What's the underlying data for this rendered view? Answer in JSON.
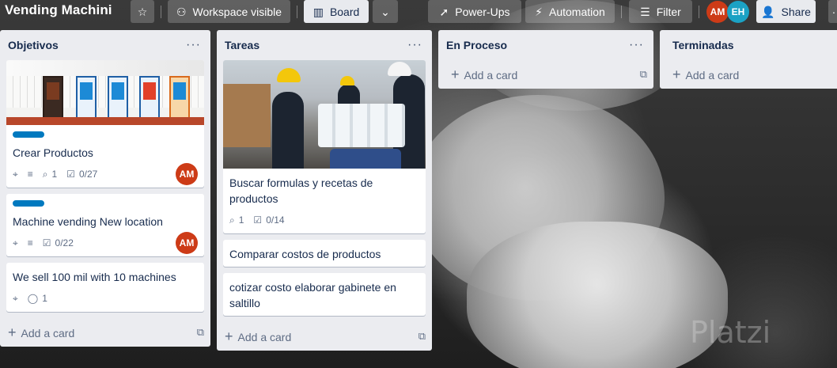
{
  "header": {
    "board_title": "Vending Machini",
    "star_icon": "star-icon",
    "visibility_label": "Workspace visible",
    "board_view_label": "Board",
    "powerups_label": "Power-Ups",
    "automation_label": "Automation",
    "filter_label": "Filter",
    "share_label": "Share",
    "members": [
      {
        "initials": "AM",
        "color": "#cd3b17"
      },
      {
        "initials": "EH",
        "color": "#1ba2c4"
      }
    ]
  },
  "lists": [
    {
      "title": "Objetivos",
      "menu": "···",
      "add_card": "Add a card",
      "cards": [
        {
          "title": "Crear Productos",
          "attachments": "1",
          "checklist": "0/27",
          "member": "AM"
        },
        {
          "title": "Machine vending New location",
          "checklist": "0/22",
          "member": "AM"
        },
        {
          "title": "We sell 100 mil with 10 machines",
          "comments": "1"
        }
      ]
    },
    {
      "title": "Tareas",
      "menu": "···",
      "add_card": "Add a card",
      "cards": [
        {
          "title": "Buscar formulas y recetas de productos",
          "attachments": "1",
          "checklist": "0/14"
        },
        {
          "title": "Comparar costos de productos"
        },
        {
          "title": "cotizar costo elaborar gabinete en saltillo"
        }
      ]
    },
    {
      "title": "En Proceso",
      "menu": "···",
      "add_card": "Add a card"
    },
    {
      "title": "Terminadas",
      "add_card": "Add a card"
    }
  ],
  "watermark": "Platzi",
  "colors": {
    "label_blue": "#0079bf",
    "avatar_am": "#cd3b17",
    "avatar_eh": "#1ba2c4"
  }
}
